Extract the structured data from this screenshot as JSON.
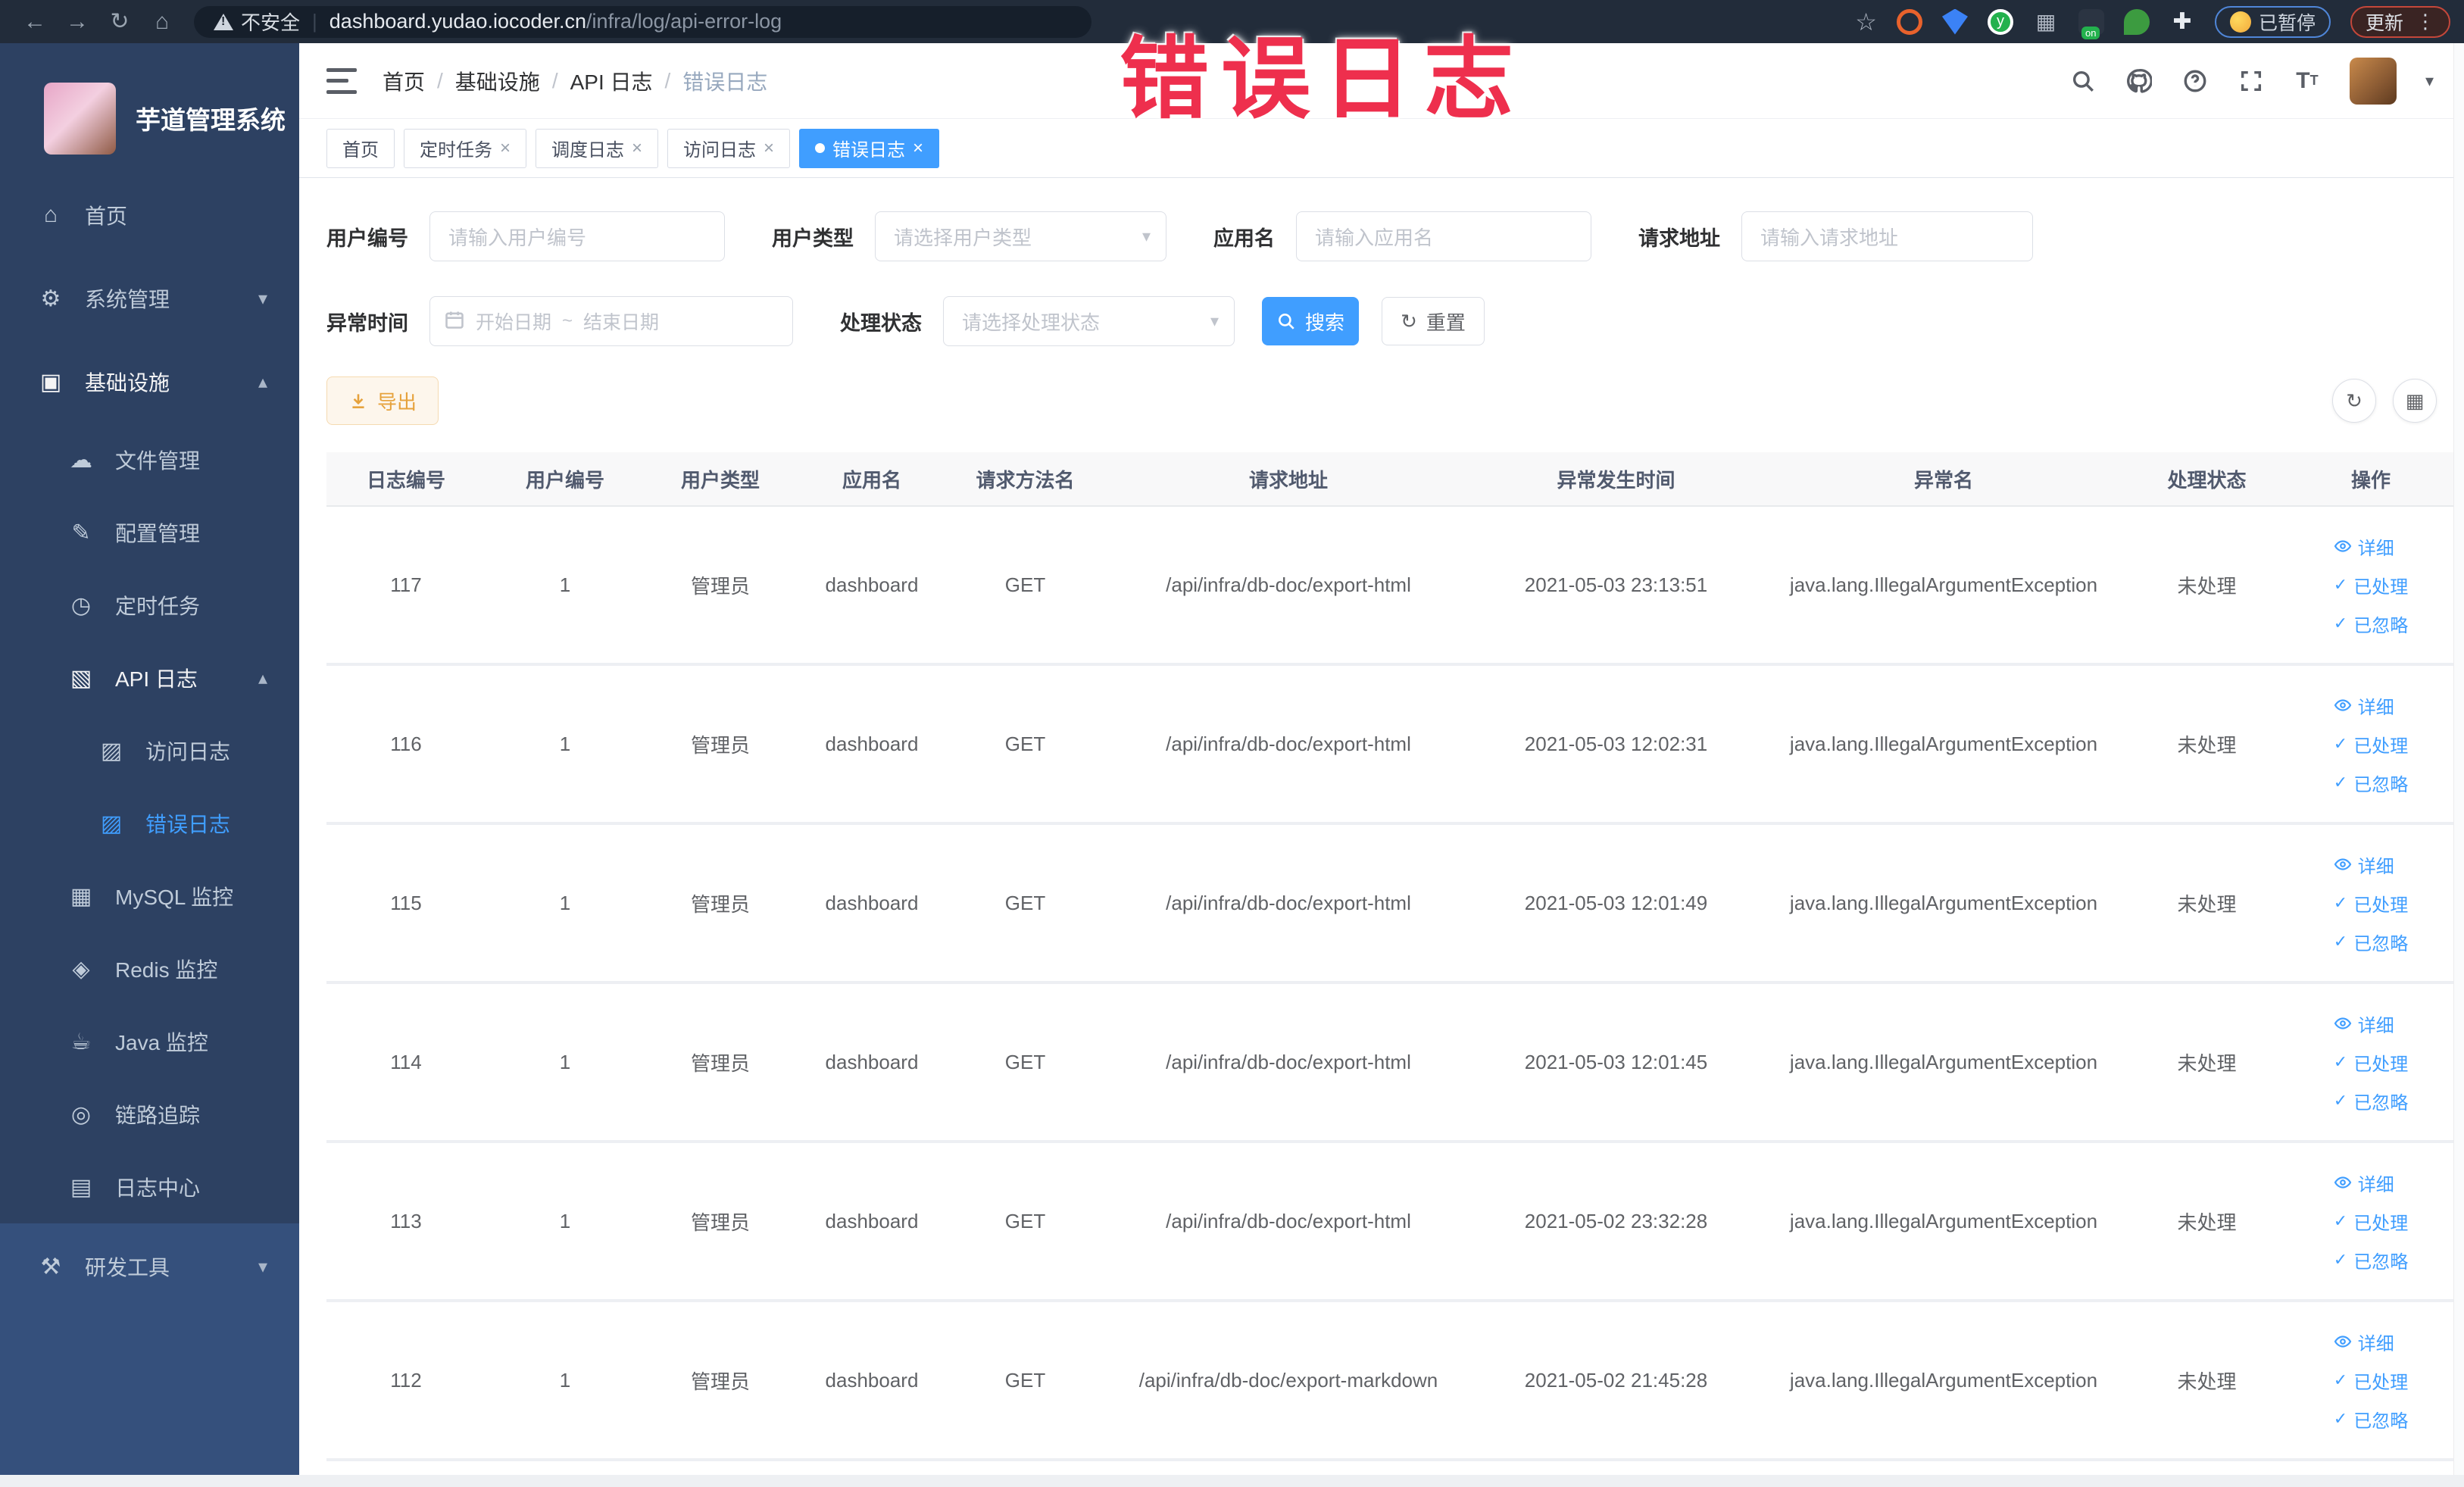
{
  "browser": {
    "security_label": "不安全",
    "url_host": "dashboard.yudao.iocoder.cn",
    "url_path": "/infra/log/api-error-log",
    "paused_badge": "已暂停",
    "update_button": "更新"
  },
  "overlay": {
    "annotation": "错误日志",
    "color": "#ee2f4d"
  },
  "sidebar": {
    "title": "芋道管理系统",
    "items": [
      {
        "name": "home",
        "icon": "home-icon",
        "glyph": "⌂",
        "label": "首页",
        "level": 0
      },
      {
        "name": "system",
        "icon": "gear-icon",
        "glyph": "⚙",
        "label": "系统管理",
        "level": 0,
        "chevron": "down"
      },
      {
        "name": "infra",
        "icon": "monitor-icon",
        "glyph": "▣",
        "label": "基础设施",
        "level": 0,
        "chevron": "up",
        "open": true
      },
      {
        "name": "file",
        "icon": "cloud-upload-icon",
        "glyph": "☁",
        "label": "文件管理",
        "level": 1
      },
      {
        "name": "config",
        "icon": "edit-icon",
        "glyph": "✎",
        "label": "配置管理",
        "level": 1
      },
      {
        "name": "job",
        "icon": "clock-icon",
        "glyph": "◷",
        "label": "定时任务",
        "level": 1
      },
      {
        "name": "api-log",
        "icon": "log-icon",
        "glyph": "▧",
        "label": "API 日志",
        "level": 1,
        "chevron": "up",
        "open": true
      },
      {
        "name": "access-log",
        "icon": "access-log-icon",
        "glyph": "▨",
        "label": "访问日志",
        "level": 2
      },
      {
        "name": "error-log",
        "icon": "error-log-icon",
        "glyph": "▨",
        "label": "错误日志",
        "level": 2,
        "active": true
      },
      {
        "name": "mysql",
        "icon": "mysql-icon",
        "glyph": "▦",
        "label": "MySQL 监控",
        "level": 1
      },
      {
        "name": "redis",
        "icon": "redis-icon",
        "glyph": "◈",
        "label": "Redis 监控",
        "level": 1
      },
      {
        "name": "java",
        "icon": "java-icon",
        "glyph": "☕",
        "label": "Java 监控",
        "level": 1
      },
      {
        "name": "trace",
        "icon": "trace-icon",
        "glyph": "◎",
        "label": "链路追踪",
        "level": 1
      },
      {
        "name": "log-center",
        "icon": "log-center-icon",
        "glyph": "▤",
        "label": "日志中心",
        "level": 1
      }
    ],
    "devtools_item": {
      "name": "devtools",
      "icon": "toolbox-icon",
      "glyph": "⚒",
      "label": "研发工具",
      "level": 0,
      "chevron": "down"
    }
  },
  "breadcrumb": [
    "首页",
    "基础设施",
    "API 日志",
    "错误日志"
  ],
  "tabs": [
    {
      "label": "首页",
      "closable": false,
      "active": false
    },
    {
      "label": "定时任务",
      "closable": true,
      "active": false
    },
    {
      "label": "调度日志",
      "closable": true,
      "active": false
    },
    {
      "label": "访问日志",
      "closable": true,
      "active": false
    },
    {
      "label": "错误日志",
      "closable": true,
      "active": true
    }
  ],
  "filters": {
    "user_id": {
      "label": "用户编号",
      "placeholder": "请输入用户编号"
    },
    "user_type": {
      "label": "用户类型",
      "placeholder": "请选择用户类型"
    },
    "app_name": {
      "label": "应用名",
      "placeholder": "请输入应用名"
    },
    "request_url": {
      "label": "请求地址",
      "placeholder": "请输入请求地址"
    },
    "exception_time": {
      "label": "异常时间",
      "start_placeholder": "开始日期",
      "separator": "~",
      "end_placeholder": "结束日期"
    },
    "process_status": {
      "label": "处理状态",
      "placeholder": "请选择处理状态"
    },
    "search_button": "搜索",
    "reset_button": "重置"
  },
  "toolbar": {
    "export_button": "导出"
  },
  "table": {
    "columns": [
      "日志编号",
      "用户编号",
      "用户类型",
      "应用名",
      "请求方法名",
      "请求地址",
      "异常发生时间",
      "异常名",
      "处理状态",
      "操作"
    ],
    "actions": [
      "详细",
      "已处理",
      "已忽略"
    ],
    "rows": [
      {
        "id": "117",
        "user_id": "1",
        "user_type": "管理员",
        "app": "dashboard",
        "method": "GET",
        "url": "/api/infra/db-doc/export-html",
        "time": "2021-05-03 23:13:51",
        "exception": "java.lang.IllegalArgumentException",
        "status": "未处理"
      },
      {
        "id": "116",
        "user_id": "1",
        "user_type": "管理员",
        "app": "dashboard",
        "method": "GET",
        "url": "/api/infra/db-doc/export-html",
        "time": "2021-05-03 12:02:31",
        "exception": "java.lang.IllegalArgumentException",
        "status": "未处理"
      },
      {
        "id": "115",
        "user_id": "1",
        "user_type": "管理员",
        "app": "dashboard",
        "method": "GET",
        "url": "/api/infra/db-doc/export-html",
        "time": "2021-05-03 12:01:49",
        "exception": "java.lang.IllegalArgumentException",
        "status": "未处理"
      },
      {
        "id": "114",
        "user_id": "1",
        "user_type": "管理员",
        "app": "dashboard",
        "method": "GET",
        "url": "/api/infra/db-doc/export-html",
        "time": "2021-05-03 12:01:45",
        "exception": "java.lang.IllegalArgumentException",
        "status": "未处理"
      },
      {
        "id": "113",
        "user_id": "1",
        "user_type": "管理员",
        "app": "dashboard",
        "method": "GET",
        "url": "/api/infra/db-doc/export-html",
        "time": "2021-05-02 23:32:28",
        "exception": "java.lang.IllegalArgumentException",
        "status": "未处理"
      },
      {
        "id": "112",
        "user_id": "1",
        "user_type": "管理员",
        "app": "dashboard",
        "method": "GET",
        "url": "/api/infra/db-doc/export-markdown",
        "time": "2021-05-02 21:45:28",
        "exception": "java.lang.IllegalArgumentException",
        "status": "未处理"
      }
    ]
  },
  "accent": {
    "primary": "#409eff",
    "warning": "#e6a23c",
    "sidebar_bg": "#2d4162"
  }
}
